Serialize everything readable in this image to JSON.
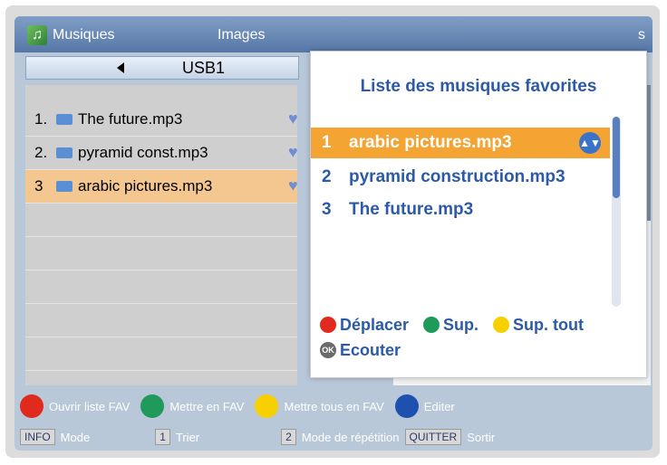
{
  "colors": {
    "red": "#e02a1e",
    "green": "#1f9a5a",
    "yellow": "#f6d000",
    "blue": "#1e50b0",
    "accent": "#f4a433"
  },
  "tabs": {
    "music": "Musiques",
    "images": "Images",
    "right_partial": "s"
  },
  "source": {
    "label": "USB1"
  },
  "list": [
    {
      "num": "1.",
      "name": "The future.mp3",
      "selected": false
    },
    {
      "num": "2.",
      "name": "pyramid const.mp3",
      "selected": false
    },
    {
      "num": "3",
      "name": "arabic pictures.mp3",
      "selected": true
    }
  ],
  "favorites": {
    "title": "Liste des musiques favorites",
    "items": [
      {
        "num": "1",
        "name": "arabic pictures.mp3",
        "selected": true
      },
      {
        "num": "2",
        "name": "pyramid construction.mp3",
        "selected": false
      },
      {
        "num": "3",
        "name": "The future.mp3",
        "selected": false
      }
    ],
    "actions": {
      "move": "Déplacer",
      "delete": "Sup.",
      "delete_all": "Sup. tout",
      "listen": "Ecouter"
    }
  },
  "player_controls": "⏮◀◀ ▶ ■ ▶▶⏭",
  "help": {
    "open_fav": "Ouvrir liste FAV",
    "set_fav": "Mettre en FAV",
    "set_all_fav": "Mettre tous en FAV",
    "edit": "Editer",
    "info_key": "INFO",
    "info_label": "Mode",
    "sort_key": "1",
    "sort_label": "Trier",
    "repeat_key": "2",
    "repeat_label": "Mode de répétition",
    "quit_key": "QUITTER",
    "quit_label": "Sortir"
  }
}
